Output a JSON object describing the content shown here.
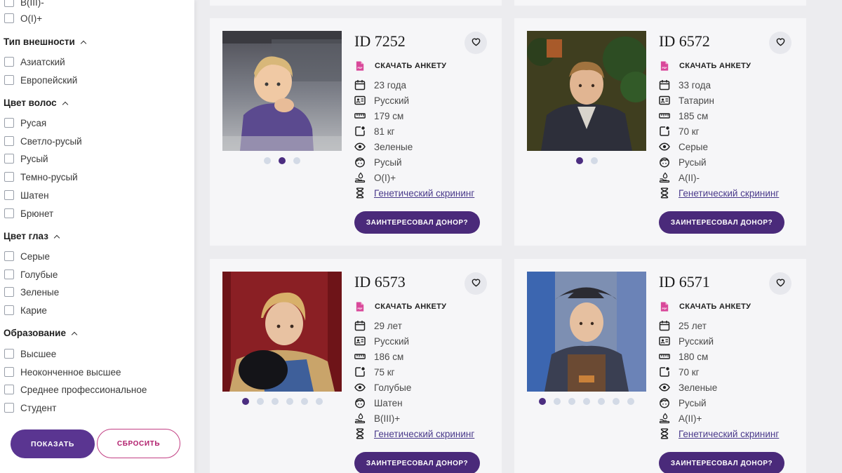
{
  "sidebar": {
    "top_partial_options": [
      "В(III)-",
      "O(I)+"
    ],
    "groups": [
      {
        "title": "Тип внешности",
        "options": [
          "Азиатский",
          "Европейский"
        ]
      },
      {
        "title": "Цвет волос",
        "options": [
          "Русая",
          "Светло-русый",
          "Русый",
          "Темно-русый",
          "Шатен",
          "Брюнет"
        ]
      },
      {
        "title": "Цвет глаз",
        "options": [
          "Серые",
          "Голубые",
          "Зеленые",
          "Карие"
        ]
      },
      {
        "title": "Образование",
        "options": [
          "Высшее",
          "Неоконченное высшее",
          "Среднее профессиональное",
          "Студент"
        ]
      }
    ],
    "show_button": "ПОКАЗАТЬ",
    "reset_button": "СБРОСИТЬ"
  },
  "cards": [
    {
      "id": "ID 7252",
      "download": "СКАЧАТЬ АНКЕТУ",
      "age": "23 года",
      "nationality": "Русский",
      "height": "179 см",
      "weight": "81 кг",
      "eyes": "Зеленые",
      "hair": "Русый",
      "blood": "O(I)+",
      "genetic": "Генетический скрининг",
      "interest_button": "ЗАИНТЕРЕСОВАЛ ДОНОР?",
      "photo_count": 3,
      "active_photo_index": 1,
      "photo_theme": "car"
    },
    {
      "id": "ID 6572",
      "download": "СКАЧАТЬ АНКЕТУ",
      "age": "33 года",
      "nationality": "Татарин",
      "height": "185 см",
      "weight": "70 кг",
      "eyes": "Серые",
      "hair": "Русый",
      "blood": "A(II)-",
      "genetic": "Генетический скрининг",
      "interest_button": "ЗАИНТЕРЕСОВАЛ ДОНОР?",
      "photo_count": 2,
      "active_photo_index": 0,
      "photo_theme": "suit"
    },
    {
      "id": "ID 6573",
      "download": "СКАЧАТЬ АНКЕТУ",
      "age": "29 лет",
      "nationality": "Русский",
      "height": "186 см",
      "weight": "75 кг",
      "eyes": "Голубые",
      "hair": "Шатен",
      "blood": "B(III)+",
      "genetic": "Генетический скрининг",
      "interest_button": "ЗАИНТЕРЕСОВАЛ ДОНОР?",
      "photo_count": 6,
      "active_photo_index": 0,
      "photo_theme": "red"
    },
    {
      "id": "ID 6571",
      "download": "СКАЧАТЬ АНКЕТУ",
      "age": "25 лет",
      "nationality": "Русский",
      "height": "180 см",
      "weight": "70 кг",
      "eyes": "Зеленые",
      "hair": "Русый",
      "blood": "A(II)+",
      "genetic": "Генетический скрининг",
      "interest_button": "ЗАИНТЕРЕСОВАЛ ДОНОР?",
      "photo_count": 7,
      "active_photo_index": 0,
      "photo_theme": "cowboy"
    }
  ],
  "colors": {
    "accent_purple": "#5a3591",
    "interest_button": "#4a2a7a",
    "reset_border": "#c23f83",
    "pdf_icon": "#d9489a",
    "card_bg": "#f6f6f8",
    "page_bg": "#ececef"
  },
  "icons": {
    "card_attrs": [
      "calendar-icon",
      "id-card-icon",
      "ruler-icon",
      "scale-icon",
      "eye-icon",
      "hair-icon",
      "blood-type-icon",
      "dna-icon"
    ],
    "download": "pdf-icon",
    "favorite": "heart-icon",
    "group_toggle": "chevron-up-icon"
  }
}
